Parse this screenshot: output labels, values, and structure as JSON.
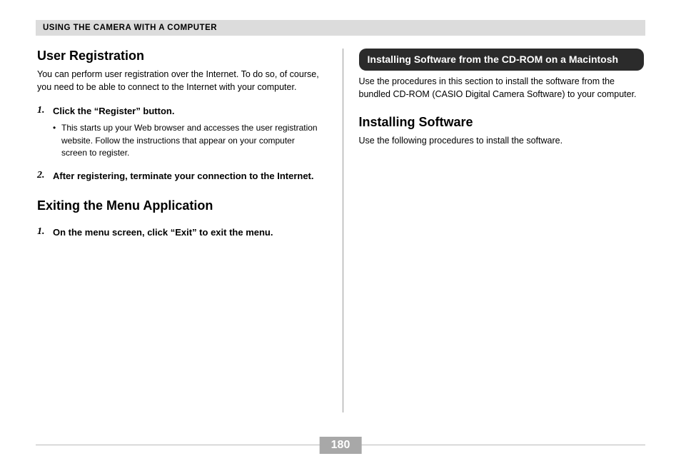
{
  "header": {
    "title": "USING THE CAMERA WITH A COMPUTER"
  },
  "left": {
    "heading1": "User Registration",
    "para1": "You can perform user registration over the Internet. To do so, of course, you need to be able to connect to the Internet with your computer.",
    "steps1": [
      {
        "num": "1.",
        "text": "Click the “Register” button.",
        "bullet": "This starts up your Web browser and accesses the user registration website. Follow the instructions that appear on your computer screen to register."
      },
      {
        "num": "2.",
        "text": "After registering, terminate your connection to the Internet."
      }
    ],
    "heading2": "Exiting the Menu Application",
    "steps2": [
      {
        "num": "1.",
        "text": "On the menu screen, click “Exit” to exit the menu."
      }
    ]
  },
  "right": {
    "callout": "Installing Software from the CD-ROM on a Macintosh",
    "para1": "Use the procedures in this section to install the software from the bundled CD-ROM (CASIO Digital Camera Software) to your computer.",
    "heading1": "Installing Software",
    "para2": "Use the following procedures to install the software."
  },
  "page_number": "180"
}
